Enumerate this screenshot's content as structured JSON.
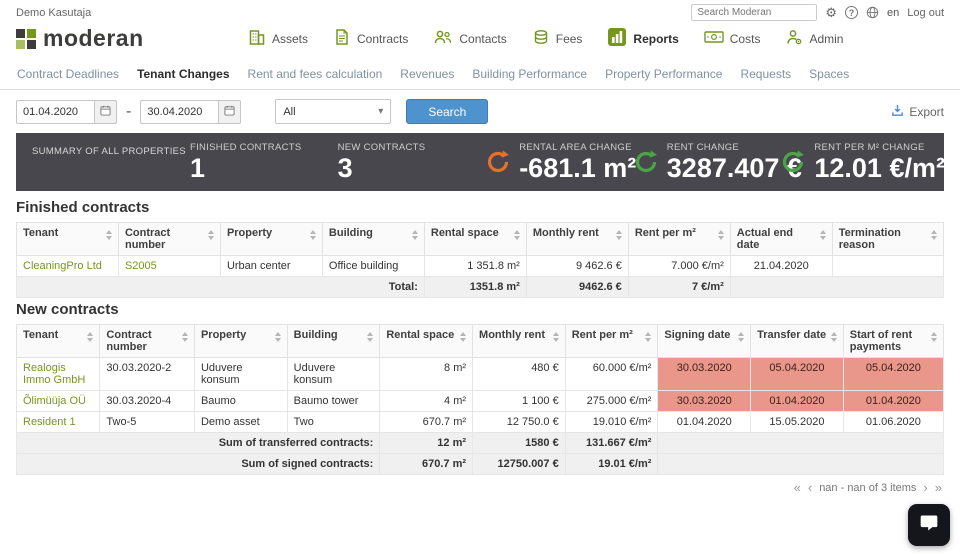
{
  "colors": {
    "brand_green": "#76961e",
    "search_button_blue": "#4f93ce",
    "summary_bar_bg": "#47474d",
    "increase_green": "#4aa546",
    "decrease_orange": "#e8702a",
    "passed_date_bg": "#e9968b"
  },
  "header": {
    "user": "Demo Kasutaja",
    "search_placeholder": "Search Moderan",
    "language": "en",
    "logout": "Log out",
    "logo": "moderan"
  },
  "nav": {
    "assets": "Assets",
    "contracts": "Contracts",
    "contacts": "Contacts",
    "fees": "Fees",
    "reports": "Reports",
    "costs": "Costs",
    "admin": "Admin"
  },
  "tabs": [
    "Contract Deadlines",
    "Tenant Changes",
    "Rent and fees calculation",
    "Revenues",
    "Building Performance",
    "Property Performance",
    "Requests",
    "Spaces"
  ],
  "active_tab": "Tenant Changes",
  "filters": {
    "date_from": "01.04.2020",
    "date_to": "30.04.2020",
    "range_separator": "-",
    "property_filter": "All",
    "search_label": "Search",
    "export_label": "Export"
  },
  "summary": {
    "title": "Summary of all properties",
    "finished": {
      "label": "Finished contracts",
      "value": "1"
    },
    "new": {
      "label": "New contracts",
      "value": "3"
    },
    "area": {
      "label": "Rental area change",
      "value": "-681.1 m²",
      "trend": "down"
    },
    "rent": {
      "label": "Rent change",
      "value": "3287.407 €",
      "trend": "up"
    },
    "rent_per_m2": {
      "label": "Rent per m² change",
      "value": "12.01 €/m²",
      "trend": "up"
    }
  },
  "finished_table": {
    "title": "Finished contracts",
    "headers": [
      "Tenant",
      "Contract number",
      "Property",
      "Building",
      "Rental space",
      "Monthly rent",
      "Rent per m²",
      "Actual end date",
      "Termination reason"
    ],
    "rows": [
      {
        "tenant": "CleaningPro Ltd",
        "number": "S2005",
        "property": "Urban center",
        "building": "Office building",
        "space": "1 351.8 m²",
        "rent": "9 462.6 €",
        "per_m2": "7.000 €/m²",
        "end_date": "21.04.2020",
        "reason": ""
      }
    ],
    "total": {
      "label": "Total:",
      "space": "1351.8 m²",
      "rent": "9462.6 €",
      "per_m2": "7 €/m²"
    }
  },
  "new_table": {
    "title": "New contracts",
    "headers": [
      "Tenant",
      "Contract number",
      "Property",
      "Building",
      "Rental space",
      "Monthly rent",
      "Rent per m²",
      "Signing date",
      "Transfer date",
      "Start of rent payments"
    ],
    "rows": [
      {
        "tenant": "Realogis Immo GmbH",
        "number": "30.03.2020-2",
        "property": "Uduvere konsum",
        "building": "Uduvere konsum",
        "space": "8 m²",
        "rent": "480 €",
        "per_m2": "60.000 €/m²",
        "signing": "30.03.2020",
        "transfer": "05.04.2020",
        "start": "05.04.2020"
      },
      {
        "tenant": "Õlimüüja OÜ",
        "number": "30.03.2020-4",
        "property": "Baumo",
        "building": "Baumo tower",
        "space": "4 m²",
        "rent": "1 100 €",
        "per_m2": "275.000 €/m²",
        "signing": "30.03.2020",
        "transfer": "01.04.2020",
        "start": "01.04.2020"
      },
      {
        "tenant": "Resident 1",
        "number": "Two-5",
        "property": "Demo asset",
        "building": "Two",
        "space": "670.7 m²",
        "rent": "12 750.0 €",
        "per_m2": "19.010 €/m²",
        "signing": "01.04.2020",
        "transfer": "15.05.2020",
        "start": "01.06.2020"
      }
    ],
    "sum_transferred": {
      "label": "Sum of transferred contracts:",
      "space": "12 m²",
      "rent": "1580 €",
      "per_m2": "131.667 €/m²"
    },
    "sum_signed": {
      "label": "Sum of signed contracts:",
      "space": "670.7 m²",
      "rent": "12750.007 €",
      "per_m2": "19.01 €/m²"
    },
    "pagination": "nan - nan of 3 items"
  }
}
